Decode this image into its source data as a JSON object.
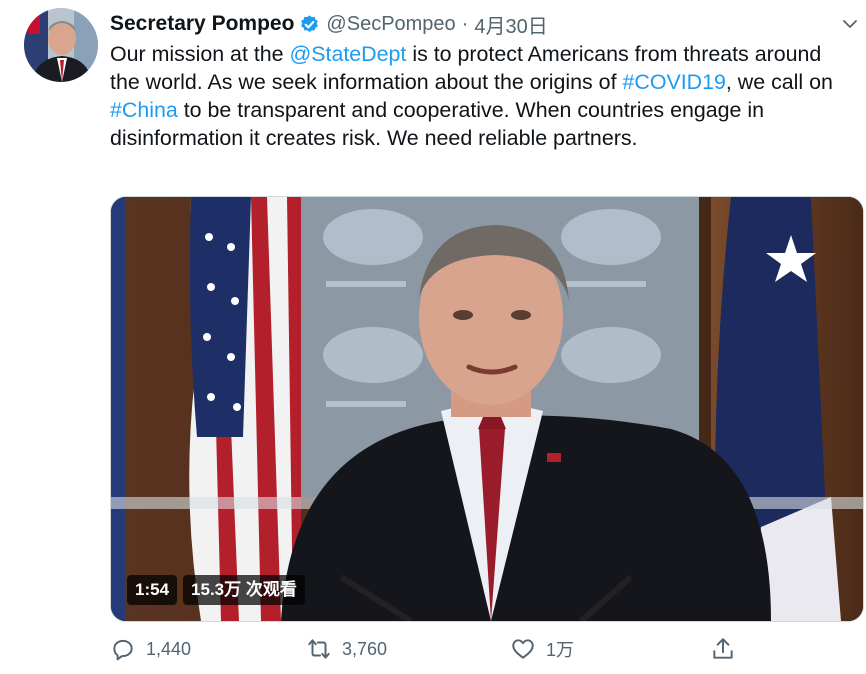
{
  "tweet": {
    "display_name": "Secretary Pompeo",
    "handle": "@SecPompeo",
    "separator": "·",
    "date": "4月30日",
    "text": {
      "t1": "Our mission at the ",
      "mention": "@StateDept",
      "t2": " is to protect Americans from threats around the world. As we seek information about the origins of ",
      "hashtag1": "#COVID19",
      "t3": ", we call on ",
      "hashtag2": "#China",
      "t4": " to be transparent and cooperative. When countries engage in disinformation it creates risk. We need reliable partners."
    },
    "video": {
      "duration": "1:54",
      "views": "15.3万 次观看"
    },
    "actions": {
      "reply_count": "1,440",
      "retweet_count": "3,760",
      "like_count": "1万"
    }
  },
  "colors": {
    "link": "#1d9bf0",
    "verified": "#1d9bf0",
    "text": "#0f1419",
    "muted": "#536471"
  },
  "icons": {
    "verified": "verified-badge-icon",
    "more": "chevron-down-icon",
    "reply": "reply-icon",
    "retweet": "retweet-icon",
    "like": "heart-icon",
    "share": "share-icon"
  }
}
